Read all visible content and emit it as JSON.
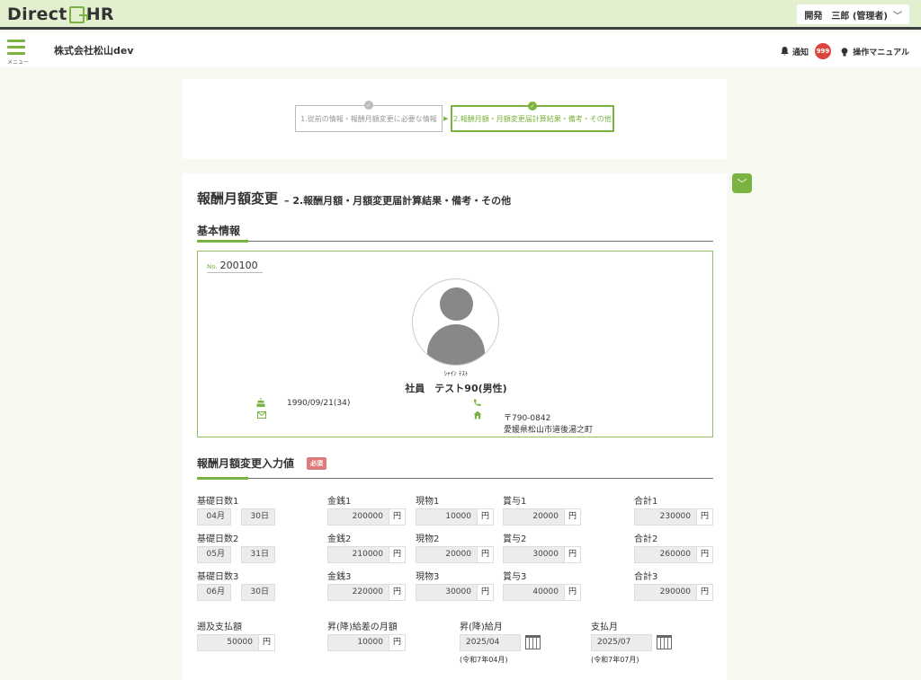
{
  "app": {
    "logo_left": "Direct",
    "logo_right": "HR",
    "user_label": "開発　三郎 (管理者)",
    "menu_label": "メニュー",
    "company": "株式会社松山dev",
    "notify_label": "通知",
    "notify_count": "999",
    "manual_label": "操作マニュアル"
  },
  "steps": [
    {
      "label": "1.従前の情報・報酬月額変更に必要な情報",
      "state": "done"
    },
    {
      "label": "2.報酬月額・月額変更届計算結果・備考・その他",
      "state": "current"
    }
  ],
  "page": {
    "title": "報酬月額変更",
    "subtitle": "– 2.報酬月額・月額変更届計算結果・備考・その他"
  },
  "basic": {
    "section_title": "基本情報",
    "no_label": "No.",
    "no_value": "200100",
    "kana": "ｼｬｲﾝ ﾃｽﾄ",
    "name": "社員　テスト90(男性)",
    "birth": "1990/09/21(34)",
    "zip": "〒790-0842",
    "address": "愛媛県松山市道後湯之町"
  },
  "input": {
    "section_title": "報酬月額変更入力値",
    "required_badge": "必須",
    "yen": "円",
    "rows": [
      {
        "base_label": "基礎日数1",
        "month": "04月",
        "days": "30日",
        "cash_label": "金銭1",
        "cash": "200000",
        "goods_label": "現物1",
        "goods": "10000",
        "bonus_label": "賞与1",
        "bonus": "20000",
        "total_label": "合計1",
        "total": "230000"
      },
      {
        "base_label": "基礎日数2",
        "month": "05月",
        "days": "31日",
        "cash_label": "金銭2",
        "cash": "210000",
        "goods_label": "現物2",
        "goods": "20000",
        "bonus_label": "賞与2",
        "bonus": "30000",
        "total_label": "合計2",
        "total": "260000"
      },
      {
        "base_label": "基礎日数3",
        "month": "06月",
        "days": "30日",
        "cash_label": "金銭3",
        "cash": "220000",
        "goods_label": "現物3",
        "goods": "30000",
        "bonus_label": "賞与3",
        "bonus": "40000",
        "total_label": "合計3",
        "total": "290000"
      }
    ],
    "retro_label": "遡及支払額",
    "retro": "50000",
    "diff_month_label": "昇(降)給差の月額",
    "diff_month": "10000",
    "raise_month_label": "昇(降)給月",
    "raise_month": "2025/04",
    "raise_month_note": "(令和7年04月)",
    "pay_month_label": "支払月",
    "pay_month": "2025/07",
    "pay_month_note": "(令和7年07月)"
  },
  "icons": {
    "menu": "hamburger-icon",
    "bell": "bell-icon",
    "bulb": "lightbulb-icon",
    "cake": "cake-icon",
    "mail": "mail-icon",
    "phone": "phone-icon",
    "home": "home-icon",
    "calendar": "calendar-icon",
    "chevron": "chevron-down-icon"
  },
  "colors": {
    "accent": "#7bb342",
    "header_bg": "#e3f0cf",
    "badge": "#d9443b",
    "required": "#e07a7a"
  }
}
